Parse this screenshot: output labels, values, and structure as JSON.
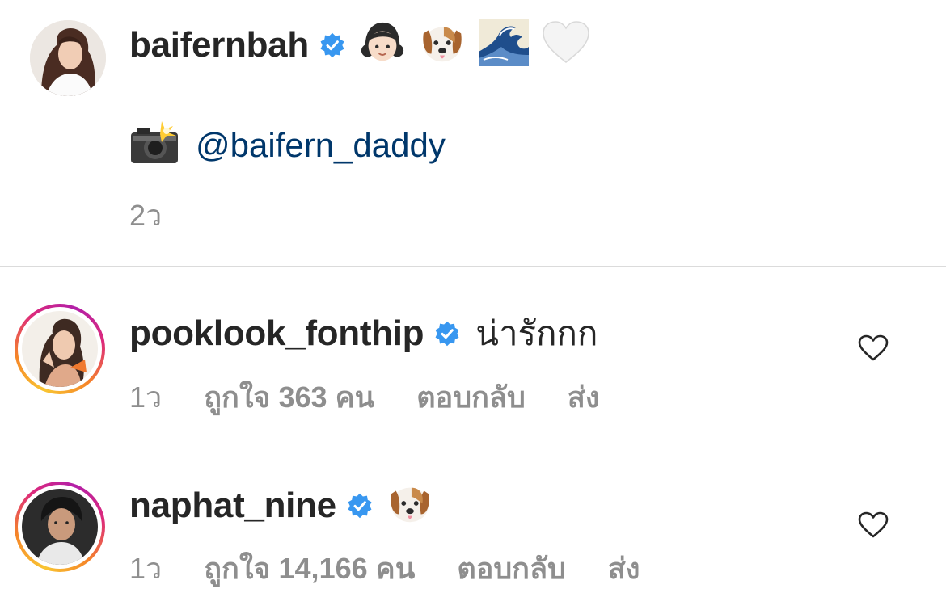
{
  "post": {
    "username": "baifernbah",
    "emojis": [
      "girl",
      "dog-face",
      "water-wave",
      "white-heart"
    ],
    "camera_emoji": "camera-with-flash",
    "mention": "@baifern_daddy",
    "time": "2ว"
  },
  "comments": [
    {
      "username": "pooklook_fonthip",
      "text": "น่ารักกก",
      "time": "1ว",
      "likes": "ถูกใจ 363 คน",
      "reply": "ตอบกลับ",
      "send": "ส่ง"
    },
    {
      "username": "naphat_nine",
      "emoji": "dog-face",
      "time": "1ว",
      "likes": "ถูกใจ 14,166 คน",
      "reply": "ตอบกลับ",
      "send": "ส่ง"
    }
  ],
  "colors": {
    "verified": "#3897f0",
    "mention": "#00376b",
    "secondary_text": "#8e8e8e",
    "divider": "#dbdbdb"
  }
}
